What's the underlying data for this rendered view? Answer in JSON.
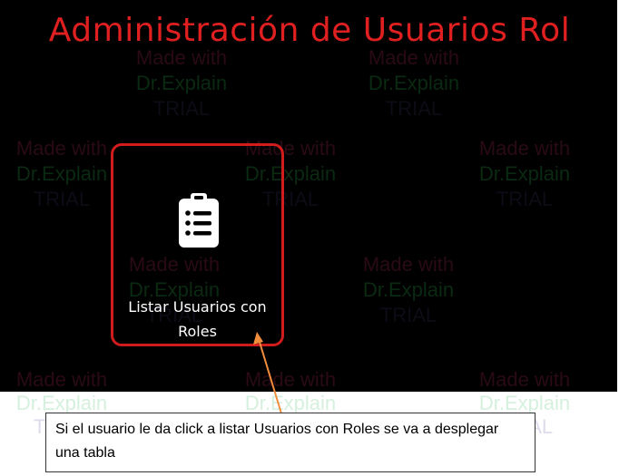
{
  "screen": {
    "title": "Administración de Usuarios Rol",
    "background_color": "#000000",
    "accent_color": "#d01c1c"
  },
  "watermark": {
    "line1": "Made with",
    "line2": "Dr.Explain",
    "line3": "TRIAL"
  },
  "tile": {
    "label": "Listar Usuarios con Roles",
    "icon": "clipboard-list-icon"
  },
  "callout": {
    "text": "Si el usuario le da click a listar Usuarios con Roles se va a desplegar una tabla",
    "arrow_color": "#f08c3c"
  }
}
